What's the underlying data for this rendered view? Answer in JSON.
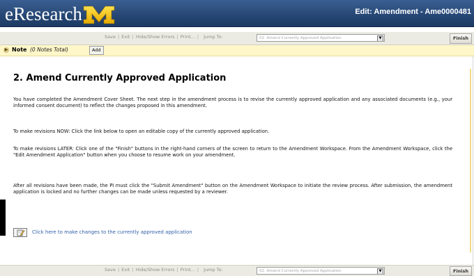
{
  "header": {
    "brand": "eResearch",
    "title": "Edit: Amendment - Ame0000481"
  },
  "toolbar": {
    "save": "Save",
    "exit": "Exit",
    "hide_show_errors": "Hide/Show Errors",
    "print": "Print...",
    "jump_to": "Jump To:",
    "jump_selected": "02. Amend Currently Approved Application",
    "finish": "Finish"
  },
  "note": {
    "label": "Note",
    "count": "(0 Notes Total)",
    "add": "Add"
  },
  "main": {
    "title": "2. Amend Currently Approved Application",
    "paragraphs": [
      "You have completed the Amendment Cover Sheet. The next step in the amendment process is to revise the currently approved application and any associated documents (e.g., your informed consent document) to reflect the changes proposed in this amendment.",
      "To make revisions NOW: Click the link below to open an editable copy of the currently approved application.",
      "To make revisions LATER: Click one of the \"Finish\" buttons in the right-hand corners of the screen to return to the Amendment Workspace. From the Amendment Workspace, click the \"Edit Amendment Application\" button when you choose to resume work on your amendment.",
      "After all revisions have been made, the PI must click the \"Submit Amendment\" button on the Amendment Workspace to initiate the review process. After submission, the amendment application is locked and no further changes can be made unless requested by a reviewer."
    ],
    "edit_link": "Click here to make changes to the currently approved application"
  },
  "colors": {
    "header_bg": "#264774",
    "maize": "#f5c400",
    "link": "#2f5fa8",
    "note_bg": "#fff7c9"
  },
  "icons": {
    "brand_logo": "block-m-logo",
    "note_toggle": "expand-arrow-icon",
    "dropdown": "chevron-down-icon",
    "edit": "edit-document-icon"
  }
}
